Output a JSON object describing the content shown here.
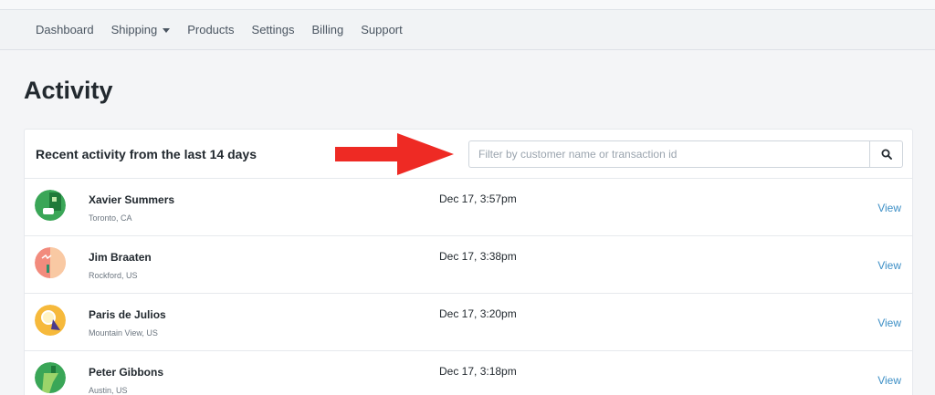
{
  "nav": {
    "items": [
      {
        "label": "Dashboard",
        "has_caret": false
      },
      {
        "label": "Shipping",
        "has_caret": true
      },
      {
        "label": "Products",
        "has_caret": false
      },
      {
        "label": "Settings",
        "has_caret": false
      },
      {
        "label": "Billing",
        "has_caret": false
      },
      {
        "label": "Support",
        "has_caret": false
      }
    ]
  },
  "page": {
    "title": "Activity"
  },
  "activity": {
    "header": "Recent activity from the last 14 days",
    "filter_placeholder": "Filter by customer name or transaction id",
    "filter_value": "",
    "search_icon": "search-icon",
    "annotation_arrow_color": "#ee2a24",
    "view_link_color": "#3d8fc6",
    "rows": [
      {
        "name": "Xavier Summers",
        "location": "Toronto, CA",
        "date": "Dec 17, 3:57pm",
        "action": "View",
        "avatar_colors": [
          "#3aa657",
          "#1f7a3a"
        ]
      },
      {
        "name": "Jim Braaten",
        "location": "Rockford, US",
        "date": "Dec 17, 3:38pm",
        "action": "View",
        "avatar_colors": [
          "#f28b7d",
          "#f9c9a3"
        ]
      },
      {
        "name": "Paris de Julios",
        "location": "Mountain View, US",
        "date": "Dec 17, 3:20pm",
        "action": "View",
        "avatar_colors": [
          "#f6b93b",
          "#4a3a8c"
        ]
      },
      {
        "name": "Peter Gibbons",
        "location": "Austin, US",
        "date": "Dec 17, 3:18pm",
        "action": "View",
        "avatar_colors": [
          "#3aa657",
          "#9bd46a"
        ]
      }
    ]
  }
}
